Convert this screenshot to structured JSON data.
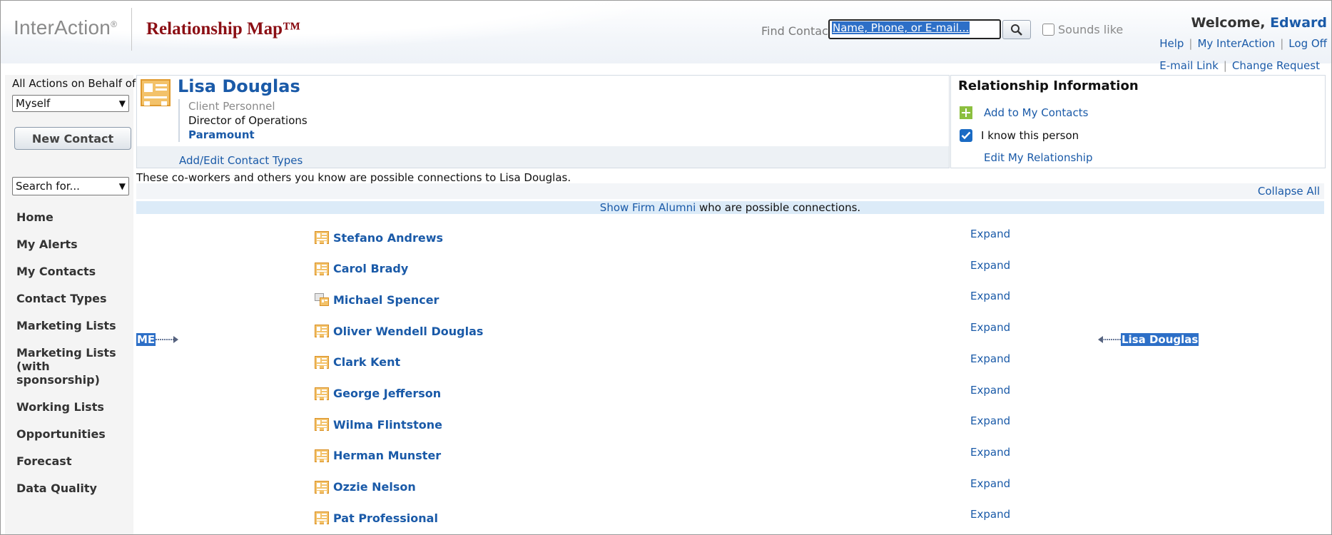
{
  "header": {
    "logo": "InterAction",
    "logo_mark": "®",
    "title": "Relationship Map™",
    "find_label": "Find Contact:",
    "find_placeholder": "Name, Phone, or E-mail...",
    "sounds_like": "Sounds like",
    "welcome_prefix": "Welcome, ",
    "user": "Edward",
    "links": [
      "Help",
      "My InterAction",
      "Log Off"
    ],
    "sub_links": [
      "E-mail Link",
      "Change Request"
    ]
  },
  "sidebar": {
    "behalf_label": "All Actions on Behalf of",
    "behalf_value": "Myself",
    "new_contact": "New Contact",
    "search_value": "Search for...",
    "nav": [
      "Home",
      "My Alerts",
      "My Contacts",
      "Contact Types",
      "Marketing Lists",
      "Marketing Lists (with sponsorship)",
      "Working Lists",
      "Opportunities",
      "Forecast",
      "Data Quality"
    ]
  },
  "contact": {
    "name": "Lisa Douglas",
    "type": "Client Personnel",
    "title": "Director of Operations",
    "company": "Paramount",
    "edit_types": "Add/Edit Contact Types"
  },
  "relationship": {
    "title": "Relationship Information",
    "add_contacts": "Add to My Contacts",
    "know_person": "I know this person",
    "know_checked": true,
    "edit": "Edit My Relationship"
  },
  "map": {
    "intro": "These co-workers and others you know are possible connections to Lisa Douglas.",
    "collapse_all": "Collapse All",
    "alumni_link": "Show Firm Alumni",
    "alumni_rest": " who are possible connections.",
    "me_label": "ME",
    "target_label": "Lisa Douglas",
    "expand_label": "Expand",
    "coworkers": [
      {
        "name": "Stefano Andrews",
        "icon": "contact-card-icon"
      },
      {
        "name": "Carol Brady",
        "icon": "contact-card-icon"
      },
      {
        "name": "Michael Spencer",
        "icon": "shared-contact-icon"
      },
      {
        "name": "Oliver Wendell Douglas",
        "icon": "contact-card-icon"
      },
      {
        "name": "Clark Kent",
        "icon": "contact-card-icon"
      },
      {
        "name": "George Jefferson",
        "icon": "contact-card-icon"
      },
      {
        "name": "Wilma Flintstone",
        "icon": "contact-card-icon"
      },
      {
        "name": "Herman Munster",
        "icon": "contact-card-icon"
      },
      {
        "name": "Ozzie Nelson",
        "icon": "contact-card-icon"
      },
      {
        "name": "Pat Professional",
        "icon": "contact-card-icon"
      }
    ]
  },
  "colors": {
    "brand_red": "#8b0e14",
    "link_blue": "#1a5aa8",
    "highlight": "#2d6fc7",
    "card_gold": "#e8a33a"
  }
}
